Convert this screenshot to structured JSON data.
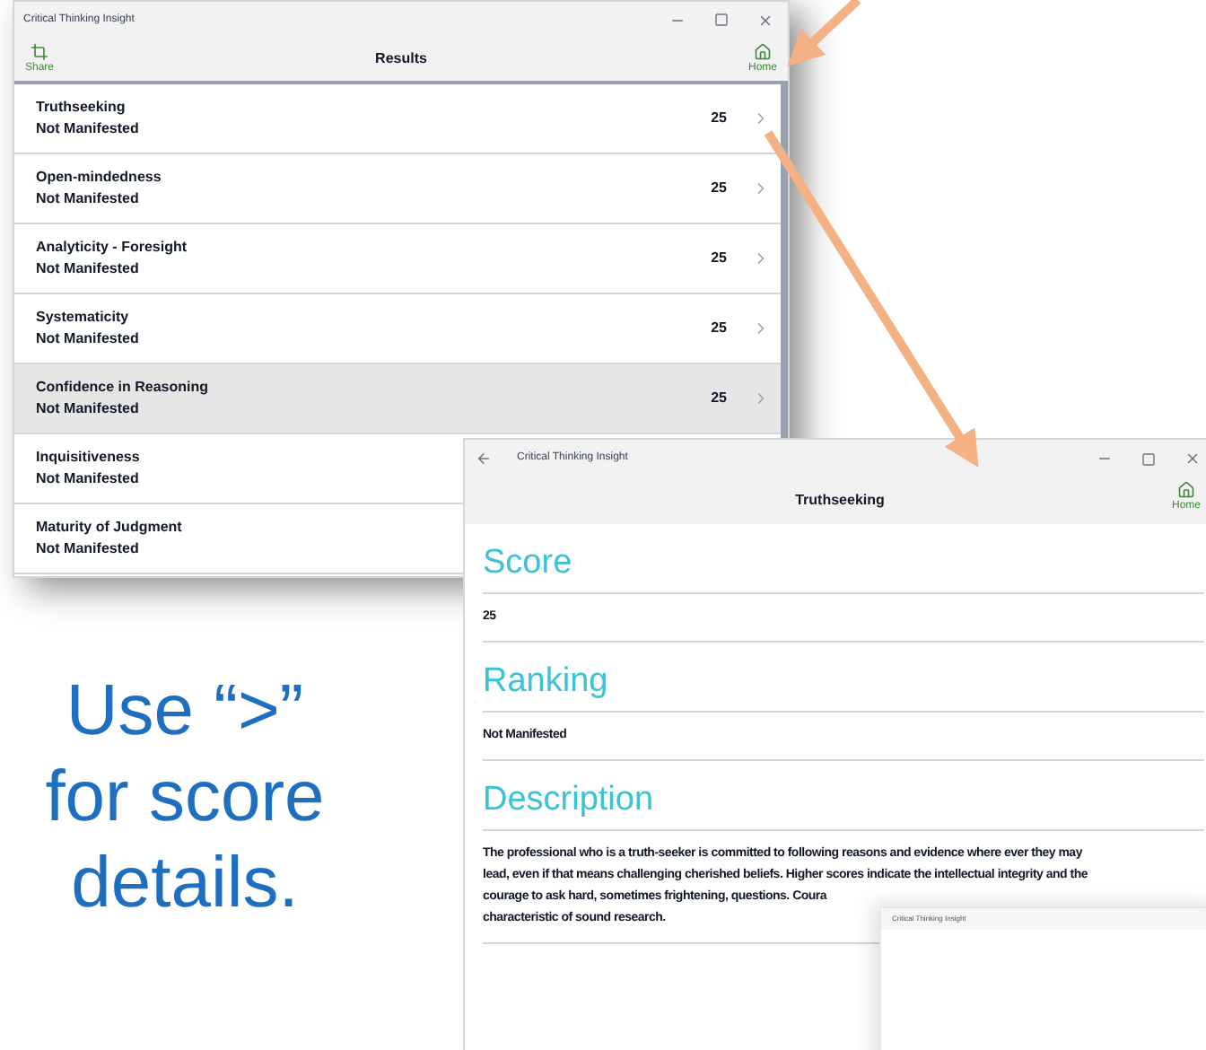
{
  "results_window": {
    "title": "Critical Thinking Insight",
    "share_label": "Share",
    "header": "Results",
    "home_label": "Home",
    "rows": [
      {
        "name": "Truthseeking",
        "status": "Not Manifested",
        "score": "25",
        "selected": false
      },
      {
        "name": "Open-mindedness",
        "status": "Not Manifested",
        "score": "25",
        "selected": false
      },
      {
        "name": "Analyticity - Foresight",
        "status": "Not Manifested",
        "score": "25",
        "selected": false
      },
      {
        "name": "Systematicity",
        "status": "Not Manifested",
        "score": "25",
        "selected": false
      },
      {
        "name": "Confidence in Reasoning",
        "status": "Not Manifested",
        "score": "25",
        "selected": true
      },
      {
        "name": "Inquisitiveness",
        "status": "Not Manifested",
        "selected": false
      },
      {
        "name": "Maturity of Judgment",
        "status": "Not Manifested",
        "selected": false
      }
    ]
  },
  "detail_window": {
    "title": "Critical Thinking Insight",
    "header": "Truthseeking",
    "home_label": "Home",
    "sections": [
      {
        "heading": "Score",
        "lines": [
          "25"
        ]
      },
      {
        "heading": "Ranking",
        "lines": [
          "Not Manifested"
        ]
      },
      {
        "heading": "Description",
        "lines": [
          "The professional who is a truth-seeker is committed to following reasons and evidence where ever they may",
          "lead, even if that means challenging cherished beliefs. Higher scores indicate the intellectual integrity and the",
          "courage to ask hard, sometimes frightening, questions. Coura",
          "characteristic of sound research."
        ]
      }
    ]
  },
  "mini_window": {
    "title": "Critical Thinking Insight"
  },
  "caption": "Use “>” for score details."
}
